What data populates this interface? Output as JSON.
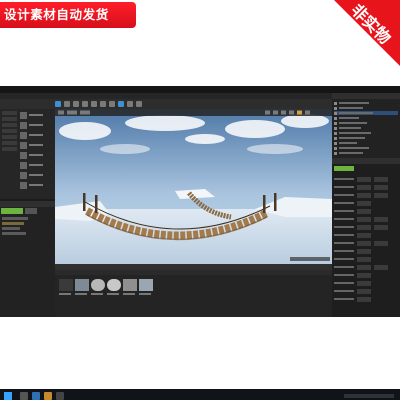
{
  "banner": {
    "text": "设计素材自动发货",
    "bg_color": "#e8141c"
  },
  "corner_badge": {
    "text": "非实物",
    "bg_color": "#e8141c"
  },
  "editor": {
    "accent_color": "#6cb33f",
    "selection_color": "#2d4f7a",
    "scene": "rope-bridge",
    "icons": {
      "windows_start": "windows-start-icon",
      "add_new": "add-new-icon",
      "play": "play-icon"
    }
  }
}
